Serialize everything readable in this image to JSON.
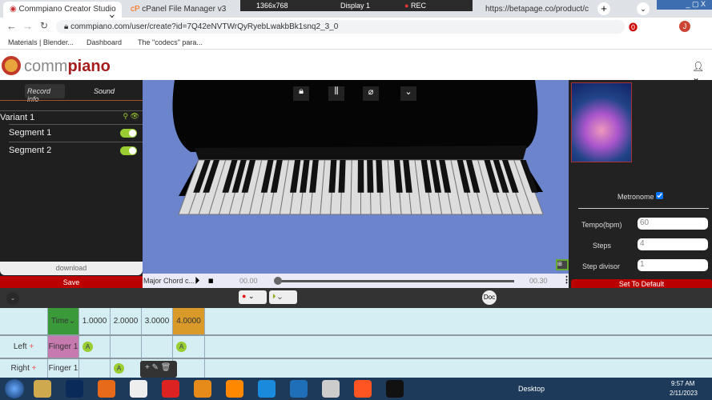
{
  "browser": {
    "tabs": [
      "Commpiano Creator Studio",
      "cPanel File Manager v3",
      "https://betapage.co/product/c"
    ],
    "recorder": {
      "size": "1366x768",
      "display": "Display 1",
      "rec": "REC"
    },
    "url": "commpiano.com/user/create?id=7Q42eNVTWrQyRyebLwakbBk1snq2_3_0",
    "bookmarks": [
      "Materials | Blender...",
      "Dashboard",
      "The \"codecs\" para..."
    ],
    "avatar": "J"
  },
  "app": {
    "logo_prefix": "comm",
    "logo_suffix": "piano"
  },
  "left": {
    "tabs": [
      "Record info",
      "Sound"
    ],
    "variant": "Variant 1",
    "segments": [
      {
        "label": "Segment 1",
        "on": true
      },
      {
        "label": "Segment 2",
        "on": true
      }
    ],
    "download": "download",
    "save": "Save"
  },
  "player": {
    "name": "Major Chord c...",
    "start": "00.00",
    "end": "00.30",
    "progress": 0
  },
  "right": {
    "metronome_label": "Metronome",
    "metronome": true,
    "tempo_label": "Tempo(bpm)",
    "tempo": "60",
    "steps_label": "Steps",
    "steps": "4",
    "divisor_label": "Step divisor",
    "divisor": "1",
    "reset": "Set To Default"
  },
  "toolbar": {
    "doc": "Doc"
  },
  "grid": {
    "time_label": "Time",
    "times": [
      "1.0000",
      "2.0000",
      "3.0000",
      "4.0000"
    ],
    "rows": [
      {
        "hand": "Left",
        "finger": "Finger 1",
        "notes": [
          "A",
          "",
          "",
          "A"
        ]
      },
      {
        "hand": "Right",
        "finger": "Finger 1",
        "notes": [
          "",
          "A",
          "",
          ""
        ]
      }
    ]
  },
  "taskbar": {
    "desktop": "Desktop",
    "time": "9:57 AM",
    "date": "2/11/2023"
  }
}
